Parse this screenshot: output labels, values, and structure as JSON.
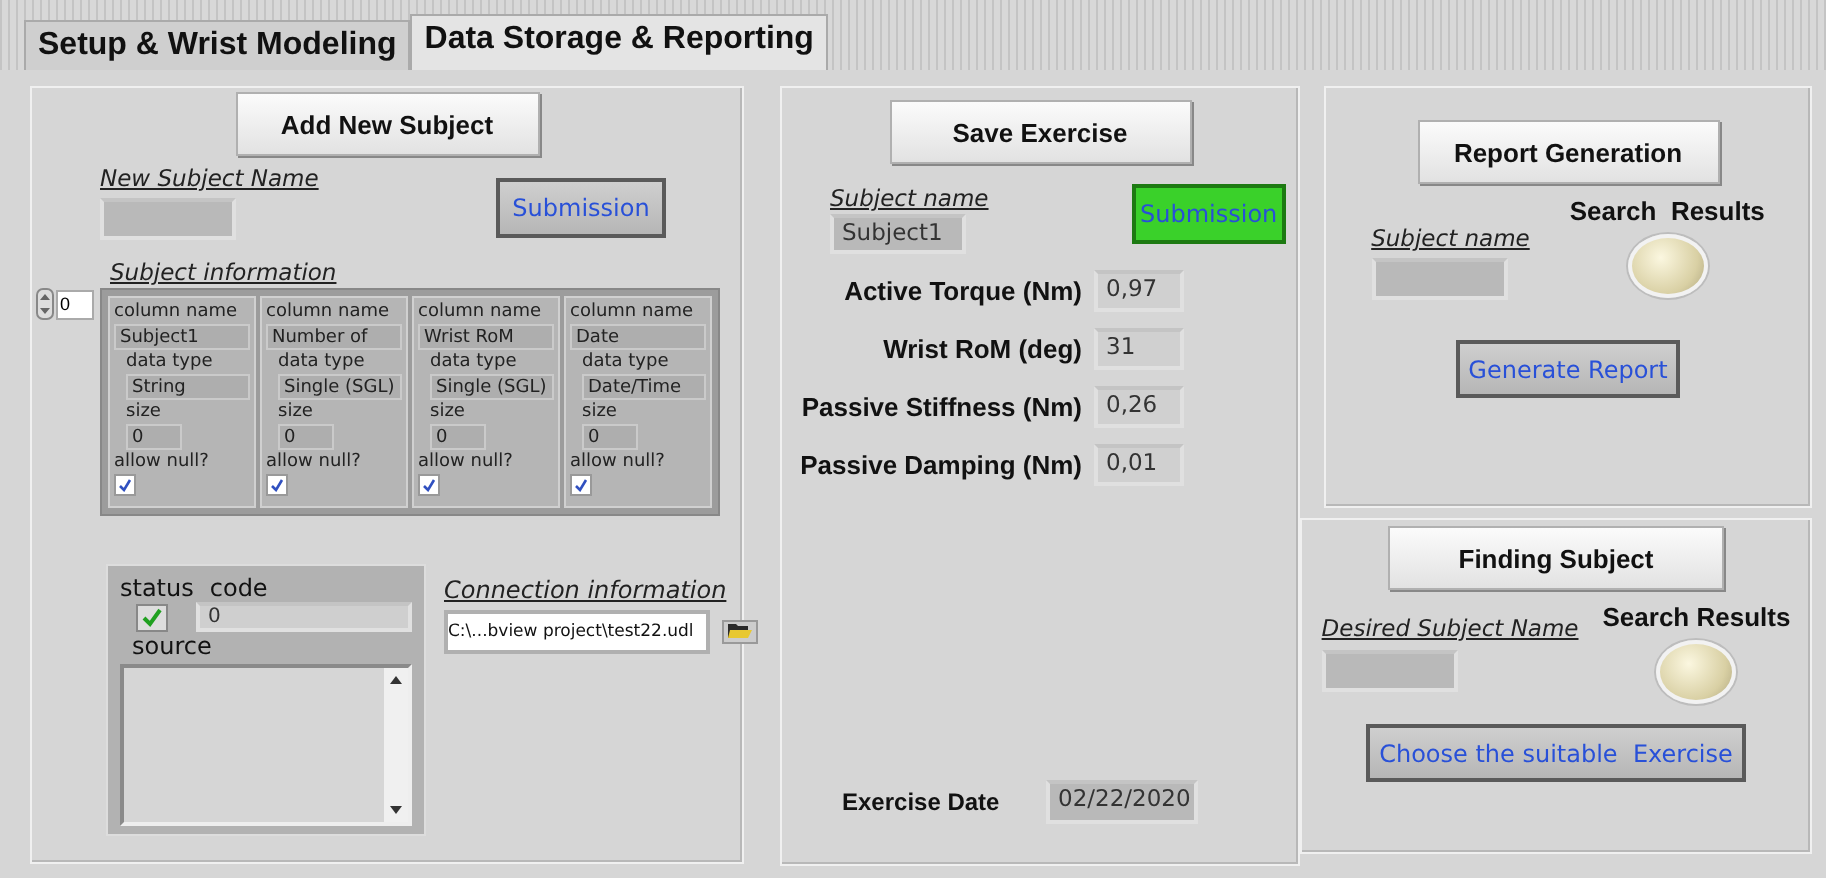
{
  "tabs": [
    {
      "label": "Setup & Wrist Modeling",
      "selected": false
    },
    {
      "label": "Data Storage & Reporting",
      "selected": true
    }
  ],
  "subject_panel": {
    "add_button": "Add New Subject",
    "new_subject_label": "New Subject Name",
    "submission": {
      "label": "Submission",
      "on": false
    },
    "subject_information": {
      "label": "Subject information",
      "index": "0",
      "columns": [
        {
          "column_name_label": "column name",
          "name": "Subject1",
          "data_type_label": "data type",
          "data_type": "String",
          "size_label": "size",
          "size": "0",
          "allow_null_label": "allow null?",
          "allow_null": true
        },
        {
          "column_name_label": "column name",
          "name": "Number of",
          "data_type_label": "data type",
          "data_type": "Single (SGL)",
          "size_label": "size",
          "size": "0",
          "allow_null_label": "allow null?",
          "allow_null": true
        },
        {
          "column_name_label": "column name",
          "name": "Wrist RoM",
          "data_type_label": "data type",
          "data_type": "Single (SGL)",
          "size_label": "size",
          "size": "0",
          "allow_null_label": "allow null?",
          "allow_null": true
        },
        {
          "column_name_label": "column name",
          "name": "Date",
          "data_type_label": "data type",
          "data_type": "Date/Time",
          "size_label": "size",
          "size": "0",
          "allow_null_label": "allow null?",
          "allow_null": true
        }
      ]
    },
    "error_cluster": {
      "status_label": "status",
      "status_ok": true,
      "code_label": "code",
      "code": "0",
      "source_label": "source"
    },
    "connection": {
      "label": "Connection information",
      "path": "C:\\...bview project\\test22.udl"
    }
  },
  "exercise_panel": {
    "button": "Save Exercise",
    "subject_label": "Subject name",
    "subject": "Subject1",
    "submission": {
      "label": "Submission",
      "on": true
    },
    "measures": [
      {
        "label": "Active Torque (Nm)",
        "value": "0,97"
      },
      {
        "label": "Wrist RoM (deg)",
        "value": "31"
      },
      {
        "label": "Passive Stiffness (Nm)",
        "value": "0,26"
      },
      {
        "label": "Passive Damping (Nm)",
        "value": "0,01"
      }
    ],
    "date_label": "Exercise Date",
    "date": "02/22/2020"
  },
  "report_panel": {
    "button": "Report Generation",
    "subject_label": "Subject name",
    "indicator_label": "Search  Results",
    "indicator_on": false,
    "action": "Generate Report"
  },
  "finding_panel": {
    "button": "Finding Subject",
    "subject_label": "Desired Subject Name",
    "indicator_label": "Search Results",
    "indicator_on": false,
    "action": "Choose the suitable  Exercise"
  }
}
